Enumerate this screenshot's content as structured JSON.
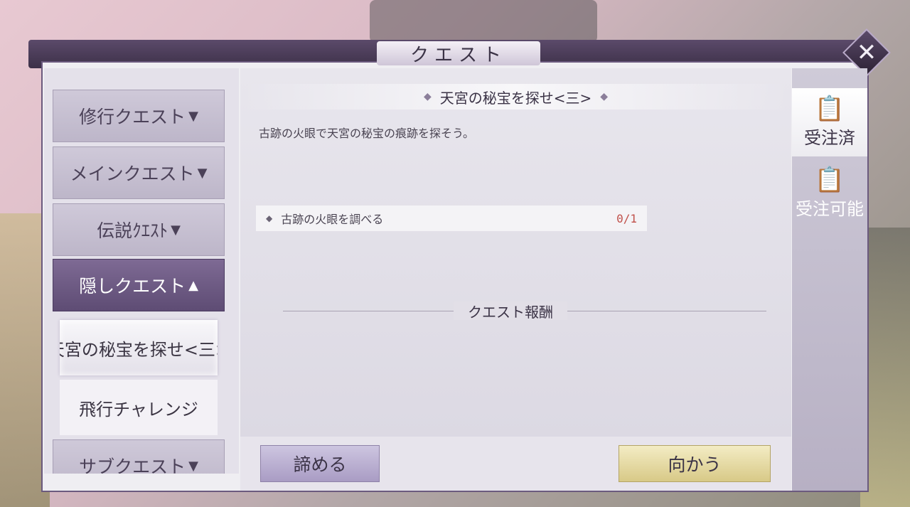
{
  "window": {
    "title": "クエスト",
    "close_icon": "close-icon"
  },
  "sidebar": {
    "categories": [
      {
        "label": "修行クエスト",
        "arrow": "▼"
      },
      {
        "label": "メインクエスト",
        "arrow": "▼"
      },
      {
        "label": "伝説ｸｴｽﾄ",
        "arrow": "▼"
      },
      {
        "label": "隠しクエスト",
        "arrow": "▲"
      },
      {
        "label": "サブクエスト",
        "arrow": "▼"
      }
    ],
    "subitems": [
      {
        "label": "天宮の秘宝を探せ<三>"
      },
      {
        "label": "飛行チャレンジ"
      }
    ]
  },
  "quest": {
    "title": "天宮の秘宝を探せ<三>",
    "description": "古跡の火眼で天宮の秘宝の痕跡を探そう。",
    "objective": {
      "label": "古跡の火眼を調べる",
      "progress": "0/1"
    },
    "reward_label": "クエスト報酬"
  },
  "buttons": {
    "give_up": "諦める",
    "go": "向かう"
  },
  "tabs": [
    {
      "label": "受注済",
      "icon": "clipboard-check-icon",
      "active": true
    },
    {
      "label": "受注可能",
      "icon": "clipboard-info-icon",
      "active": false
    }
  ],
  "colors": {
    "accent": "#5e4c74",
    "progress": "#c0504a",
    "go_button": "#d8c987"
  }
}
